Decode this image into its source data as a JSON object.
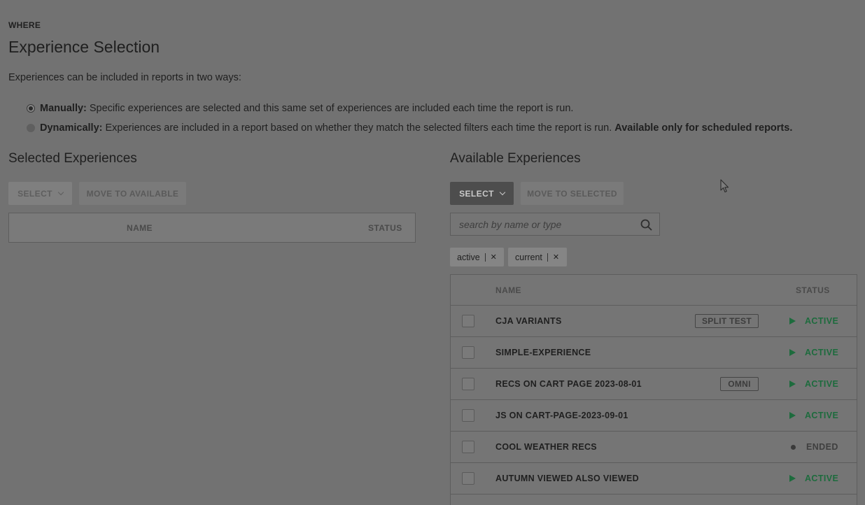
{
  "header": {
    "eyebrow": "WHERE",
    "title": "Experience Selection",
    "intro": "Experiences can be included in reports in two ways:"
  },
  "options": [
    {
      "label": "Manually:",
      "text": "Specific experiences are selected and this same set of experiences are included each time the report is run.",
      "note": "",
      "checked": true
    },
    {
      "label": "Dynamically:",
      "text": "Experiences are included in a report based on whether they match the selected filters each time the report is run.",
      "note": "Available only for scheduled reports.",
      "checked": false
    }
  ],
  "selected": {
    "title": "Selected Experiences",
    "select_label": "SELECT",
    "move_label": "MOVE TO AVAILABLE",
    "col_name": "NAME",
    "col_status": "STATUS"
  },
  "available": {
    "title": "Available Experiences",
    "select_label": "SELECT",
    "move_label": "MOVE TO SELECTED",
    "search_placeholder": "search by name or type",
    "filters": [
      "active",
      "current"
    ],
    "col_name": "NAME",
    "col_status": "STATUS",
    "rows": [
      {
        "name": "CJA VARIANTS",
        "tag": "SPLIT TEST",
        "status": "ACTIVE"
      },
      {
        "name": "SIMPLE-EXPERIENCE",
        "tag": "",
        "status": "ACTIVE"
      },
      {
        "name": "RECS ON CART PAGE 2023-08-01",
        "tag": "OMNI",
        "status": "ACTIVE"
      },
      {
        "name": "JS ON CART-PAGE-2023-09-01",
        "tag": "",
        "status": "ACTIVE"
      },
      {
        "name": "COOL WEATHER RECS",
        "tag": "",
        "status": "ENDED"
      },
      {
        "name": "AUTUMN VIEWED ALSO VIEWED",
        "tag": "",
        "status": "ACTIVE"
      }
    ]
  },
  "colors": {
    "overlay_bg": "#727272",
    "active_status": "#1d6b3d",
    "ended_status": "#3f3f3f"
  }
}
